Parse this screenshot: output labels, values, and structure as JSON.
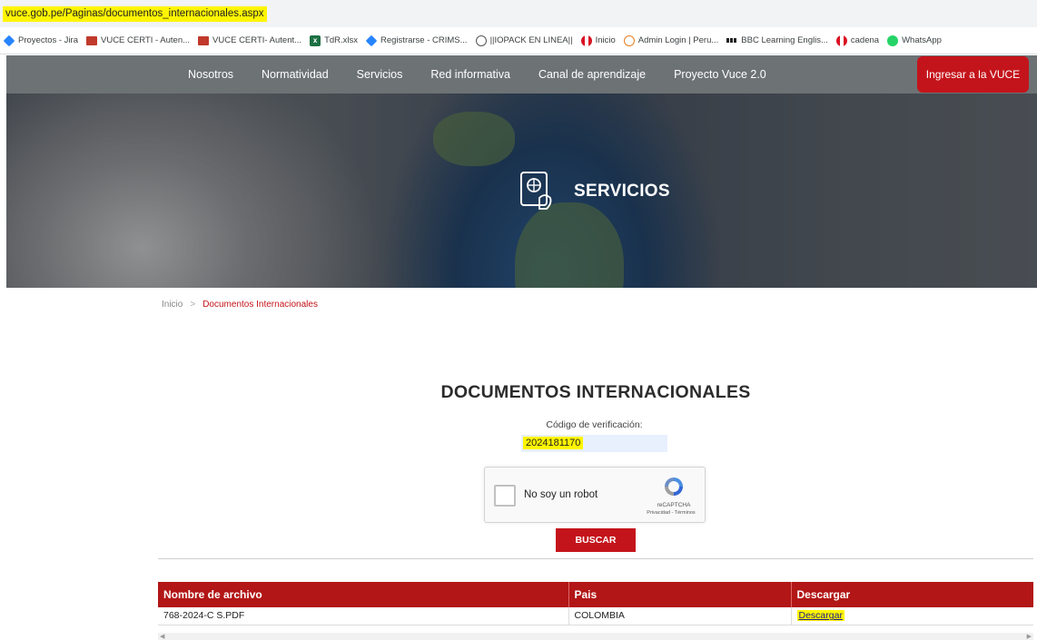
{
  "browser": {
    "url": "vuce.gob.pe/Paginas/documentos_internacionales.aspx",
    "bookmarks": [
      {
        "label": "Proyectos - Jira",
        "icon": "jira-icon"
      },
      {
        "label": "VUCE CERTI - Auten...",
        "icon": "vuce-icon"
      },
      {
        "label": "VUCE CERTI- Autent...",
        "icon": "vuce-icon"
      },
      {
        "label": "TdR.xlsx",
        "icon": "excel-icon"
      },
      {
        "label": "Registrarse - CRIMS...",
        "icon": "jira-icon"
      },
      {
        "label": "||IOPACK EN LINEA||",
        "icon": "globe-icon"
      },
      {
        "label": "Inicio",
        "icon": "peru-icon"
      },
      {
        "label": "Admin Login | Peru...",
        "icon": "admin-icon"
      },
      {
        "label": "BBC Learning Englis...",
        "icon": "bbc-icon"
      },
      {
        "label": "cadena",
        "icon": "peru-icon"
      },
      {
        "label": "WhatsApp",
        "icon": "whatsapp-icon"
      }
    ]
  },
  "nav": {
    "items": [
      "Nosotros",
      "Normatividad",
      "Servicios",
      "Red informativa",
      "Canal de aprendizaje",
      "Proyecto Vuce 2.0"
    ],
    "login_label": "Ingresar a la VUCE"
  },
  "hero": {
    "title": "SERVICIOS",
    "icon": "passport-icon"
  },
  "breadcrumb": {
    "home": "Inicio",
    "separator": ">",
    "current": "Documentos Internacionales"
  },
  "main": {
    "title": "DOCUMENTOS INTERNACIONALES",
    "code_label": "Código de verificación:",
    "code_value": "2024181170",
    "captcha_label": "No soy un robot",
    "captcha_brand": "reCAPTCHA",
    "captcha_terms": "Privacidad - Términos",
    "search_label": "BUSCAR"
  },
  "results": {
    "headers": [
      "Nombre de archivo",
      "Pais",
      "Descargar"
    ],
    "rows": [
      {
        "file": "768-2024-C S.PDF",
        "country": "COLOMBIA",
        "download": "Descargar"
      }
    ]
  },
  "colors": {
    "accent_red": "#c4141b",
    "table_header": "#b21616",
    "highlight": "#fff500",
    "nav_bg": "#6d7275"
  }
}
